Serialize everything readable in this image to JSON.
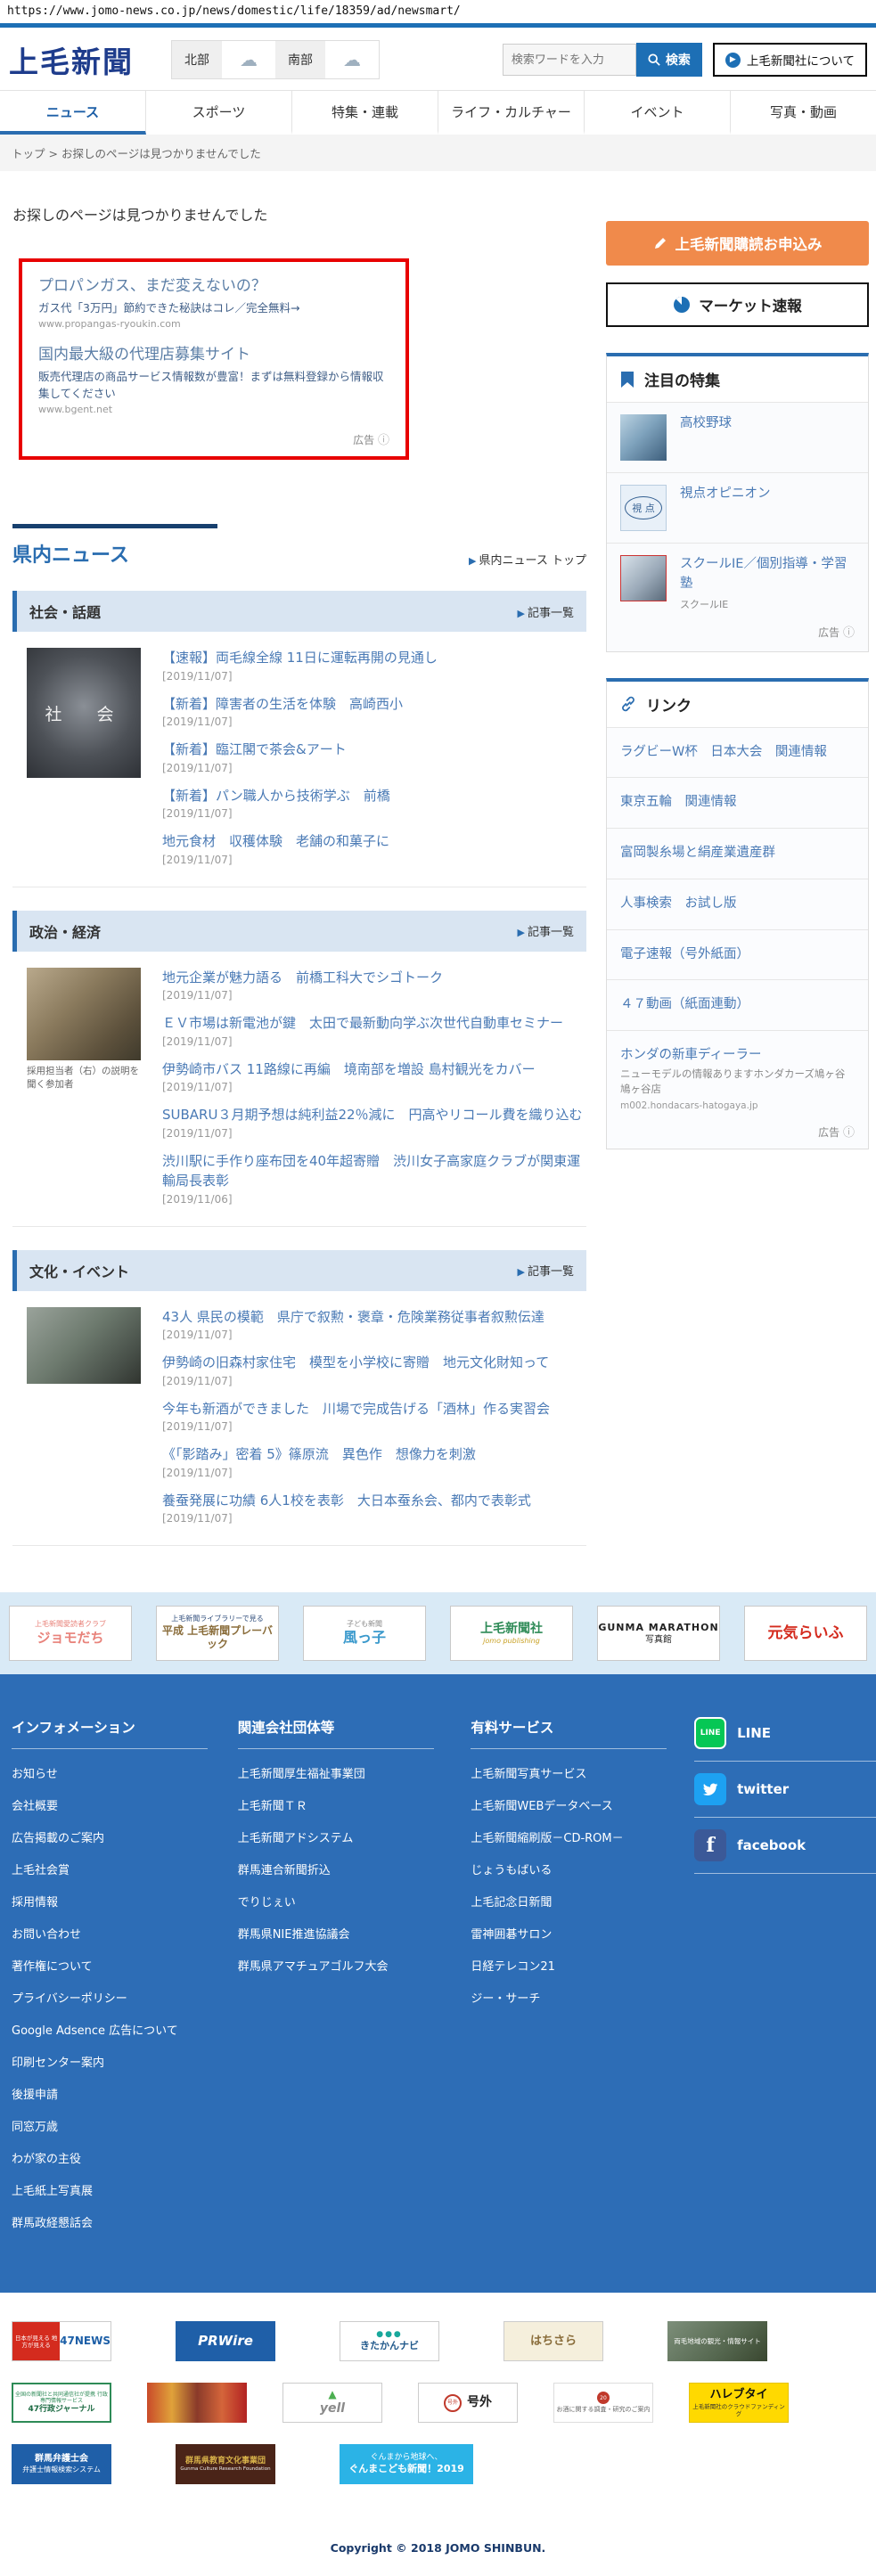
{
  "browser": {
    "url": "https://www.jomo-news.co.jp/news/domestic/life/18359/ad/newsmart/"
  },
  "header": {
    "logo": "上毛新聞",
    "weather": {
      "north_label": "北部",
      "south_label": "南部"
    },
    "search_placeholder": "検索ワードを入力",
    "search_button": "検索",
    "about_button": "上毛新聞社について"
  },
  "nav": {
    "tab1": "ニュース",
    "tab2": "スポーツ",
    "tab3": "特集・連載",
    "tab4": "ライフ・カルチャー",
    "tab5": "イベント",
    "tab6": "写真・動画"
  },
  "breadcrumb": {
    "home": "トップ",
    "separator": ">",
    "current": "お探しのページは見つかりませんでした"
  },
  "page": {
    "error_title": "お探しのページは見つかりませんでした"
  },
  "ad_box": {
    "ads": [
      {
        "title": "プロパンガス、まだ変えないの？",
        "desc": "ガス代「3万円」節約できた秘訣はコレ／完全無料→",
        "url": "www.propangas-ryoukin.com"
      },
      {
        "title": "国内最大級の代理店募集サイト",
        "desc": "販売代理店の商品サービス情報数が豊富！まずは無料登録から情報収集してください",
        "url": "www.bgent.net"
      }
    ],
    "ad_label": "広告"
  },
  "kennai": {
    "title": "県内ニュース",
    "top_link": "県内ニュース トップ",
    "list_link": "記事一覧"
  },
  "sections": [
    {
      "title": "社会・話題",
      "thumb_text": "社　会",
      "items": [
        {
          "title": "【速報】両毛線全線 11日に運転再開の見通し",
          "date": "[2019/11/07]"
        },
        {
          "title": "【新着】障害者の生活を体験　高崎西小",
          "date": "[2019/11/07]"
        },
        {
          "title": "【新着】臨江閣で茶会&アート",
          "date": "[2019/11/07]"
        },
        {
          "title": "【新着】パン職人から技術学ぶ　前橋",
          "date": "[2019/11/07]"
        },
        {
          "title": "地元食材　収穫体験　老舗の和菓子に",
          "date": "[2019/11/07]"
        }
      ]
    },
    {
      "title": "政治・経済",
      "caption": "採用担当者（右）の説明を聞く参加者",
      "items": [
        {
          "title": "地元企業が魅力語る　前橋工科大でシゴトーク",
          "date": "[2019/11/07]"
        },
        {
          "title": "ＥＶ市場は新電池が鍵　太田で最新動向学ぶ次世代自動車セミナー",
          "date": "[2019/11/07]"
        },
        {
          "title": "伊勢崎市バス 11路線に再編　境南部を増設 島村観光をカバー",
          "date": "[2019/11/07]"
        },
        {
          "title": "SUBARU３月期予想は純利益22％減に　円高やリコール費を織り込む",
          "date": "[2019/11/07]"
        },
        {
          "title": "渋川駅に手作り座布団を40年超寄贈　渋川女子高家庭クラブが関東運輸局長表彰",
          "date": "[2019/11/06]"
        }
      ]
    },
    {
      "title": "文化・イベント",
      "items": [
        {
          "title": "43人 県民の模範　県庁で叙勲・褒章・危険業務従事者叙勲伝達",
          "date": "[2019/11/07]"
        },
        {
          "title": "伊勢崎の旧森村家住宅　模型を小学校に寄贈　地元文化財知って",
          "date": "[2019/11/07]"
        },
        {
          "title": "今年も新酒ができました　川場で完成告げる「酒林」作る実習会",
          "date": "[2019/11/07]"
        },
        {
          "title": "《「影踏み」密着 5》篠原流　異色作　想像力を刺激",
          "date": "[2019/11/07]"
        },
        {
          "title": "養蚕発展に功績 6人1校を表彰　大日本蚕糸会、都内で表彰式",
          "date": "[2019/11/07]"
        }
      ]
    }
  ],
  "sidebar": {
    "subscribe_button": "上毛新聞購読お申込み",
    "market_button": "マーケット速報",
    "featured": {
      "title": "注目の特集",
      "item1": "高校野球",
      "item2": "視点オピニオン",
      "item2_thumb": "視 点",
      "item3": "スクールIE／個別指導・学習塾",
      "item3_sub": "スクールIE",
      "ad_label": "広告"
    },
    "links": {
      "title": "リンク",
      "item1": "ラグビーW杯　日本大会　関連情報",
      "item2": "東京五輪　関連情報",
      "item3": "富岡製糸場と絹産業遺産群",
      "item4": "人事検索　お試し版",
      "item5": "電子速報（号外紙面）",
      "item6": "４７動画（紙面連動）",
      "ad_item": {
        "title": "ホンダの新車ディーラー",
        "desc": "ニューモデルの情報ありますホンダカーズ鳩ヶ谷 鳩ヶ谷店",
        "url": "m002.hondacars-hatogaya.jp",
        "ad_label": "広告"
      }
    }
  },
  "banner_strip": {
    "b1_sub": "上毛新聞愛読者クラブ",
    "b1_main": "ジョモだち",
    "b2_sub": "上毛新聞ライブラリーで見る",
    "b2_main": "平成 上毛新聞プレーバック",
    "b3_sub": "子ども新聞",
    "b3_main": "風っ子",
    "b4_main": "上毛新聞社",
    "b4_sub": "jomo publishing",
    "b5_main": "GUNMA MARATHON",
    "b5_sub": "写真館",
    "b6_main": "元気らいふ"
  },
  "footer": {
    "col1": {
      "title": "インフォメーション",
      "links": [
        "お知らせ",
        "会社概要",
        "広告掲載のご案内",
        "上毛社会賞",
        "採用情報",
        "お問い合わせ",
        "著作権について",
        "プライバシーポリシー",
        "Google Adsence 広告について",
        "印刷センター案内",
        "後援申請",
        "同窓万歳",
        "わが家の主役",
        "上毛紙上写真展",
        "群馬政経懇話会"
      ]
    },
    "col2": {
      "title": "関連会社団体等",
      "links": [
        "上毛新聞厚生福祉事業団",
        "上毛新聞ＴＲ",
        "上毛新聞アドシステム",
        "群馬連合新聞折込",
        "でりじぇい",
        "群馬県NIE推進協議会",
        "群馬県アマチュアゴルフ大会"
      ]
    },
    "col3": {
      "title": "有料サービス",
      "links": [
        "上毛新聞写真サービス",
        "上毛新聞WEBデータベース",
        "上毛新聞縮刷版－CD-ROM－",
        "じょうもばいる",
        "上毛記念日新聞",
        "雷神囲碁サロン",
        "日経テレコン21",
        "ジー・サーチ"
      ]
    },
    "sns": {
      "line": "LINE",
      "twitter": "twitter",
      "facebook": "facebook"
    }
  },
  "bottom_ads": {
    "r1b1a": "日本が見える 地方が見える",
    "r1b1b": "47NEWS",
    "r1b2": "PRWire",
    "r1b3a": "●●●",
    "r1b3b": "きたかんナビ",
    "r1b4": "はちさら",
    "r1b5": "両毛地域の観光・情報サイト",
    "r2b1a": "全国の新聞社と共同通信社が提携 行政専門情報サービス",
    "r2b1b": "47行政ジャーナル",
    "r2b3a": "▲",
    "r2b3b": "yell",
    "r2b4a": "号外",
    "r2b4_stamp": "号外",
    "r2b5a": "20",
    "r2b5b": "お酒に関する調査・研究のご案内",
    "r2b6a": "ハレブタイ",
    "r2b6b": "上毛新聞社のクラウドファンディング",
    "r3b1a": "群馬弁護士会",
    "r3b1b": "弁護士情報検索システム",
    "r3b2a": "群馬県教育文化事業団",
    "r3b2b": "Gunma Culture Research Foundation",
    "r3b3a": "ぐんまから地球へ、",
    "r3b3b": "ぐんまこども新聞！2019"
  },
  "copyright": "Copyright © 2018 JOMO SHINBUN."
}
